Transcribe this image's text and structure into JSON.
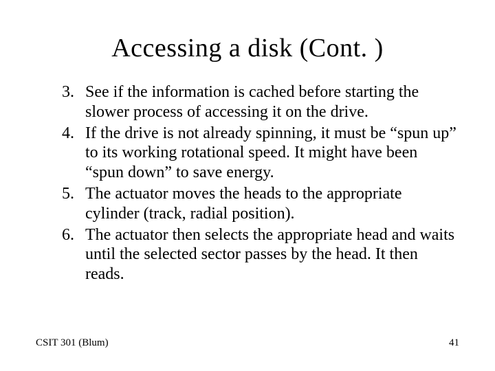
{
  "title": "Accessing a disk (Cont. )",
  "items": [
    {
      "n": "3.",
      "text": "See if the information is cached before starting the slower process of accessing it on the drive."
    },
    {
      "n": "4.",
      "text": "If the drive is not already spinning, it must be “spun up” to its working rotational speed.  It might have been “spun down” to save energy."
    },
    {
      "n": "5.",
      "text": "The actuator moves the heads to the appropriate cylinder (track, radial position)."
    },
    {
      "n": "6.",
      "text": "The actuator then selects the appropriate head and waits until the selected sector passes by the head. It then reads."
    }
  ],
  "footer_left": "CSIT 301 (Blum)",
  "footer_right": "41"
}
